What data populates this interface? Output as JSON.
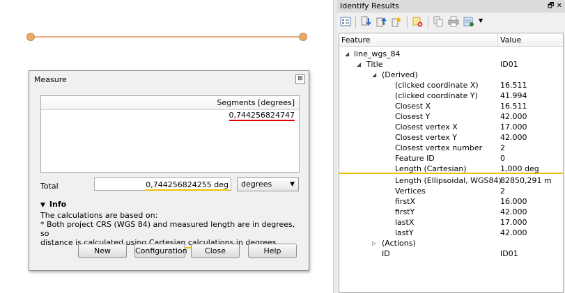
{
  "measure": {
    "title": "Measure",
    "close_glyph": "⊠",
    "segments_header": "Segments [degrees]",
    "segments": [
      "0,744256824747"
    ],
    "total_label": "Total",
    "total_value": "0,744256824255 deg",
    "unit": "degrees",
    "info_title": "Info",
    "info_line1": "The calculations are based on:",
    "info_line2": "* Both project CRS (WGS 84) and measured length are in degrees, so",
    "info_line3_pre": "distance is calculated using ",
    "info_line3_hl": "Cartesian calculations",
    "info_line3_post": " in degrees.",
    "buttons": {
      "new": "New",
      "configuration": "Configuration",
      "close": "Close",
      "help": "Help"
    }
  },
  "identify": {
    "title": "Identify Results",
    "title_btns": "🗗 ✕",
    "col_feature": "Feature",
    "col_value": "Value",
    "layer": "line_wgs_84",
    "title_row": {
      "feature": "Title",
      "value": "ID01"
    },
    "derived_label": "(Derived)",
    "derived": [
      {
        "feature": "(clicked coordinate X)",
        "value": "16.511"
      },
      {
        "feature": "(clicked coordinate Y)",
        "value": "41.994"
      },
      {
        "feature": "Closest X",
        "value": "16.511"
      },
      {
        "feature": "Closest Y",
        "value": "42.000"
      },
      {
        "feature": "Closest vertex X",
        "value": "17.000"
      },
      {
        "feature": "Closest vertex Y",
        "value": "42.000"
      },
      {
        "feature": "Closest vertex number",
        "value": "2"
      },
      {
        "feature": "Feature ID",
        "value": "0"
      },
      {
        "feature": "Length (Cartesian)",
        "value": "1,000 deg"
      },
      {
        "feature": "Length (Ellipsoidal, WGS84)",
        "value": "82850,291 m"
      },
      {
        "feature": "Vertices",
        "value": "2"
      },
      {
        "feature": "firstX",
        "value": "16.000"
      },
      {
        "feature": "firstY",
        "value": "42.000"
      },
      {
        "feature": "lastX",
        "value": "17.000"
      },
      {
        "feature": "lastY",
        "value": "42.000"
      }
    ],
    "actions_label": "(Actions)",
    "id_row": {
      "feature": "ID",
      "value": "ID01"
    }
  }
}
